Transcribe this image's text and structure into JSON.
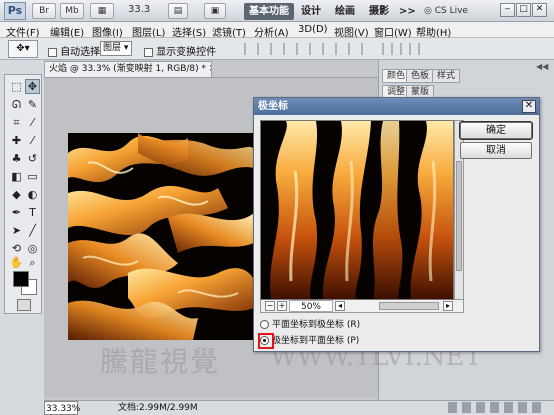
{
  "app": {
    "logo": "Ps",
    "zoom": "33.3",
    "workspaces": [
      "基本功能",
      "设计",
      "绘画",
      "摄影"
    ],
    "overflow": ">>",
    "cs_live": "CS Live"
  },
  "menu": [
    "文件(F)",
    "编辑(E)",
    "图像(I)",
    "图层(L)",
    "选择(S)",
    "滤镜(T)",
    "分析(A)",
    "3D(D)",
    "视图(V)",
    "窗口(W)",
    "帮助(H)"
  ],
  "options": {
    "auto_select_label": "自动选择:",
    "auto_select_value": "图层",
    "show_transform_label": "显示变换控件"
  },
  "document": {
    "tab_title": "火焰 @ 33.3% (渐变映射 1, RGB/8) *"
  },
  "panels": {
    "row1": [
      "颜色",
      "色板",
      "样式"
    ],
    "row2": [
      "调整",
      "蒙版"
    ]
  },
  "status": {
    "zoom": "33.33%",
    "doc_info": "文档:2.99M/2.99M"
  },
  "dialog": {
    "title": "极坐标",
    "ok": "确定",
    "cancel": "取消",
    "zoom_value": "50%",
    "option1": "平面坐标到极坐标 (R)",
    "option2": "极坐标到平面坐标 (P)",
    "selected": 2
  },
  "watermark": {
    "cn": "騰龍視覺",
    "url": "WWW.TLVI.NET"
  }
}
